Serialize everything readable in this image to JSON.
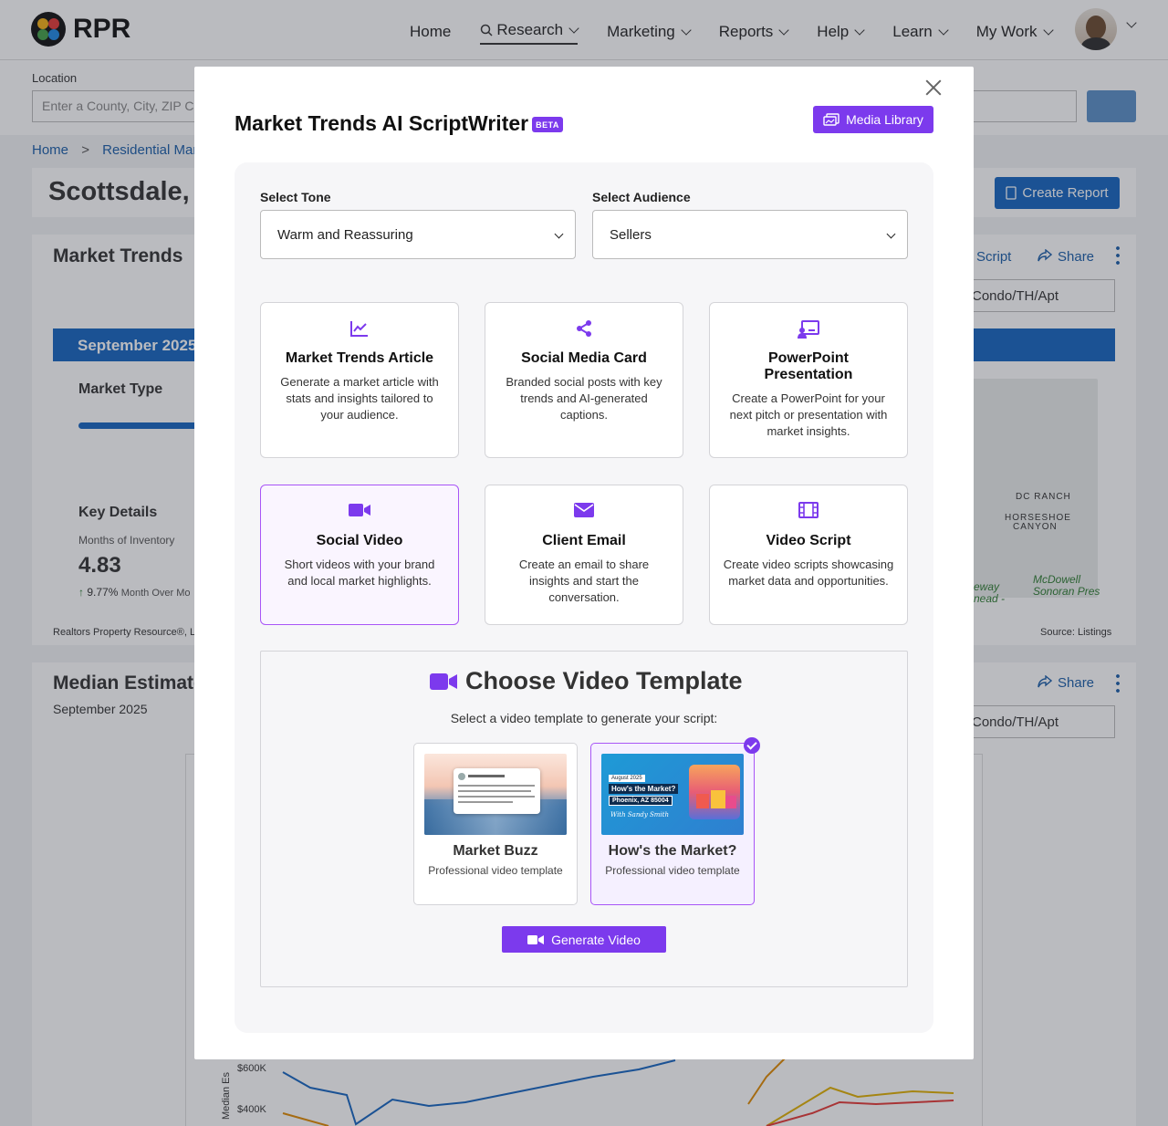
{
  "header": {
    "logo_text": "RPR",
    "nav": [
      "Home",
      "Research",
      "Marketing",
      "Reports",
      "Help",
      "Learn",
      "My Work"
    ]
  },
  "location": {
    "label": "Location",
    "placeholder": "Enter a County, City, ZIP Co"
  },
  "breadcrumb": {
    "home": "Home",
    "sep": ">",
    "current": "Residential Marke"
  },
  "page": {
    "title": "Scottsdale, A",
    "create_report": "Create Report"
  },
  "background": {
    "market_trends": "Market Trends",
    "script": "Script",
    "share": "Share",
    "property_type": "Condo/TH/Apt",
    "month": "September 2025",
    "market_type": "Market Type",
    "key_details": "Key Details",
    "months_inventory": "Months of Inventory",
    "inventory_value": "4.83",
    "inventory_change": "9.77%",
    "inventory_change_note": "Month Over Mo",
    "footer_left": "Realtors Property Resource®, L",
    "source": "Source: Listings",
    "median_title": "Median Estimate",
    "median_month": "September 2025",
    "share2": "Share",
    "property_type2": "Condo/TH/Apt",
    "y600": "$600K",
    "y400": "$400K",
    "ylabel": "Median Es",
    "map_labels": [
      "DC RANCH",
      "HORSESHOE",
      "CANYON",
      "McDowell",
      "Sonoran Pres",
      "eway",
      "nead -"
    ]
  },
  "modal": {
    "title": "Market Trends AI ScriptWriter",
    "beta": "BETA",
    "media_library": "Media Library",
    "tone_label": "Select Tone",
    "tone_value": "Warm and Reassuring",
    "audience_label": "Select Audience",
    "audience_value": "Sellers",
    "options": [
      {
        "title": "Market Trends Article",
        "desc": "Generate a market article with stats and insights tailored to your audience.",
        "icon": "chart-line-icon"
      },
      {
        "title": "Social Media Card",
        "desc": "Branded social posts with key trends and AI-generated captions.",
        "icon": "share-nodes-icon"
      },
      {
        "title": "PowerPoint Presentation",
        "desc": "Create a PowerPoint for your next pitch or presentation with market insights.",
        "icon": "presentation-icon"
      },
      {
        "title": "Social Video",
        "desc": "Short videos with your brand and local market highlights.",
        "icon": "video-camera-icon"
      },
      {
        "title": "Client Email",
        "desc": "Create an email to share insights and start the conversation.",
        "icon": "envelope-icon"
      },
      {
        "title": "Video Script",
        "desc": "Create video scripts showcasing market data and opportunities.",
        "icon": "film-icon"
      }
    ],
    "selected_option": "Social Video",
    "template_title": "Choose Video Template",
    "template_subtitle": "Select a video template to generate your script:",
    "templates": [
      {
        "name": "Market Buzz",
        "desc": "Professional video template"
      },
      {
        "name": "How's the Market?",
        "desc": "Professional video template",
        "thumb_date": "August 2025",
        "thumb_title": "How's the Market?",
        "thumb_loc": "Phoenix, AZ 85004",
        "thumb_by": "With Sandy Smith"
      }
    ],
    "selected_template": "How's the Market?",
    "generate_button": "Generate Video"
  },
  "colors": {
    "accent": "#7c3aed",
    "brand_blue": "#1565c0"
  }
}
